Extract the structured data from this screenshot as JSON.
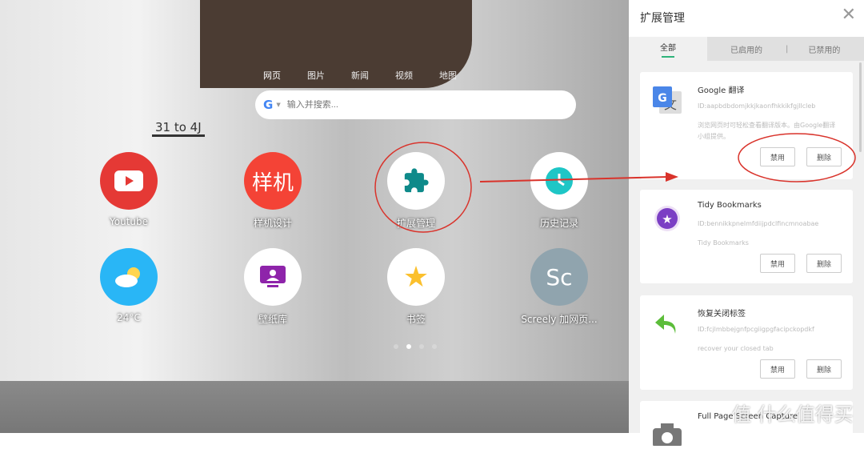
{
  "background": {
    "sign": "31 to 4J"
  },
  "search": {
    "tabs": [
      "网页",
      "图片",
      "新闻",
      "视频",
      "地图"
    ],
    "engine_icon": "google-g-icon",
    "placeholder": "输入并搜索..."
  },
  "apps": [
    {
      "label": "Youtube",
      "icon": "youtube-icon",
      "color": "#e53935"
    },
    {
      "label": "样机设计",
      "icon_text": "样机",
      "color": "#f44336"
    },
    {
      "label": "扩展管理",
      "icon": "puzzle-icon",
      "color": "#0e8a8a"
    },
    {
      "label": "历史记录",
      "icon": "clock-icon",
      "color": "#1ec6c6"
    },
    {
      "label": "24°C",
      "icon": "weather-icon",
      "color": "#29b6f6"
    },
    {
      "label": "壁纸库",
      "icon": "wallpaper-icon",
      "color": "#8e24aa"
    },
    {
      "label": "书签",
      "icon": "star-icon",
      "color": "#fbc02d"
    },
    {
      "label": "Screely 加网页...",
      "icon_text": "Sc",
      "color": "#90a4ae"
    }
  ],
  "pager": {
    "pages": 4,
    "active": 2
  },
  "panel": {
    "title": "扩展管理",
    "tabs": [
      "全部",
      "已启用的",
      "已禁用的"
    ],
    "active_tab": "全部",
    "accent": "#2fb37a",
    "disable_label": "禁用",
    "delete_label": "删除",
    "extensions": [
      {
        "name": "Google 翻译",
        "id": "ID:aapbdbdomjkkjkaonfhkkikfgjllcleb",
        "desc": "浏览网页时可轻松查看翻译版本。由Google翻译小组提供。",
        "icon": "google-translate-icon"
      },
      {
        "name": "Tidy Bookmarks",
        "id": "ID:bennikkpnelmfdiijpdclfincmnoabae",
        "desc": "Tidy Bookmarks",
        "icon": "star-badge-icon"
      },
      {
        "name": "恢复关闭标签",
        "id": "ID:fcjlmbbejgnfpcgiigpgfacipckopdkf",
        "desc": "recover your closed tab",
        "icon": "undo-arrow-icon"
      },
      {
        "name": "Full Page Screen Capture",
        "icon": "camera-icon"
      }
    ]
  },
  "watermark": "值 什么值得买"
}
